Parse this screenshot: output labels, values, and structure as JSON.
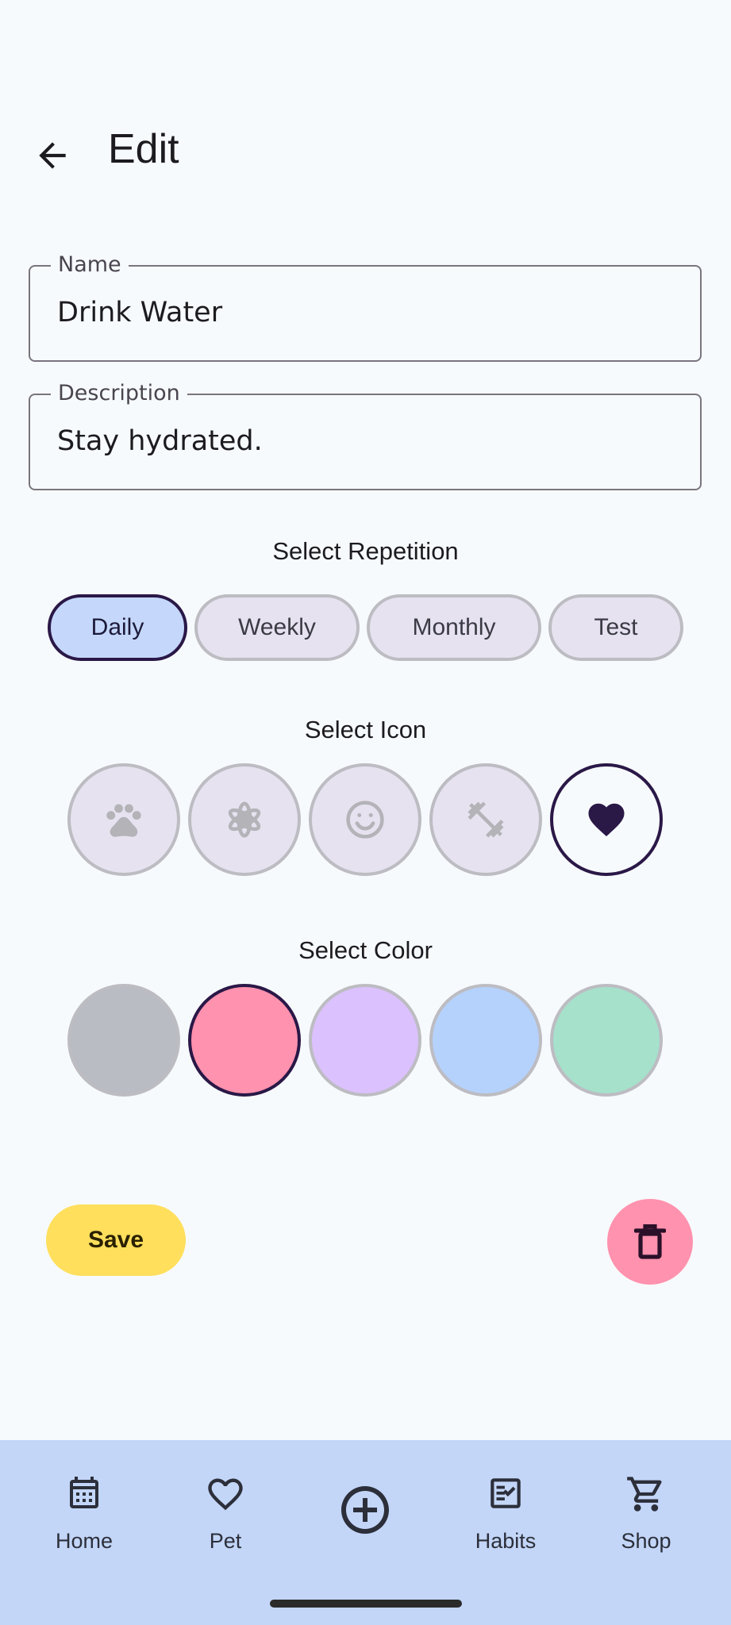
{
  "app_bar": {
    "title": "Edit"
  },
  "form": {
    "name": {
      "label": "Name",
      "value": "Drink Water"
    },
    "description": {
      "label": "Description",
      "value": "Stay hydrated."
    }
  },
  "repetition": {
    "title": "Select Repetition",
    "options": [
      "Daily",
      "Weekly",
      "Monthly",
      "Test"
    ],
    "selected": "Daily"
  },
  "icon_picker": {
    "title": "Select Icon",
    "icons": [
      "paw-icon",
      "flower-icon",
      "smiley-icon",
      "dumbbell-icon",
      "heart-icon"
    ],
    "selected": "heart-icon"
  },
  "color_picker": {
    "title": "Select Color",
    "colors": [
      "#b9bcc3",
      "#ff92ae",
      "#dcc1ff",
      "#b5d2fd",
      "#a6e1cb"
    ],
    "selected": "#ff92ae"
  },
  "actions": {
    "save_label": "Save"
  },
  "bottom_nav": {
    "items": [
      {
        "label": "Home",
        "icon": "calendar-icon"
      },
      {
        "label": "Pet",
        "icon": "heart-outline-icon"
      },
      {
        "label": "",
        "icon": "add-circle-icon"
      },
      {
        "label": "Habits",
        "icon": "checklist-icon"
      },
      {
        "label": "Shop",
        "icon": "cart-icon"
      }
    ]
  },
  "colors": {
    "background": "#f7fafc",
    "chip_selected": "#c5d8fb",
    "chip_default": "#e6e2f0",
    "selected_border": "#2a1847",
    "save_button": "#ffdf5c",
    "delete_button": "#ff92ae",
    "nav_background": "#c3d6f8"
  }
}
